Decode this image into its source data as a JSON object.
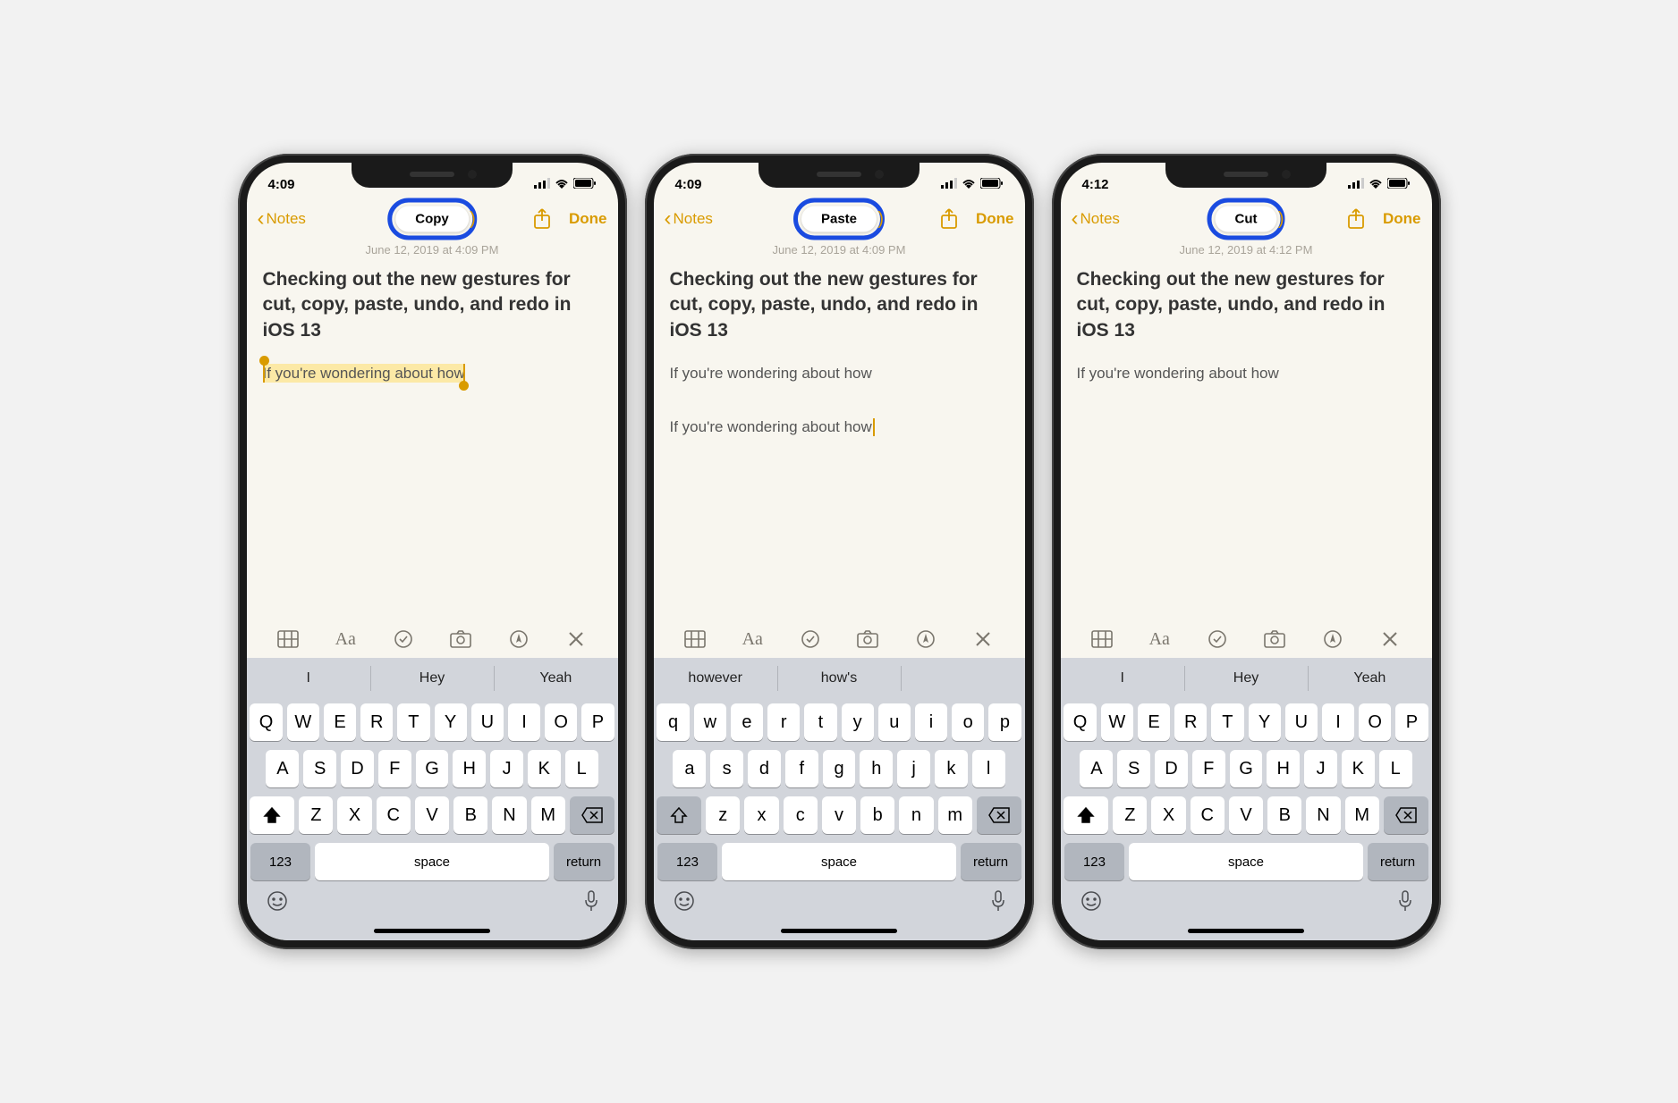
{
  "phones": [
    {
      "statusTime": "4:09",
      "backLabel": "Notes",
      "doneLabel": "Done",
      "badgeLabel": "Copy",
      "timestamp": "June 12, 2019 at 4:09 PM",
      "heading": "Checking out the new gestures for cut, copy, paste, undo, and redo in  iOS 13",
      "body1": "If you're wondering about how",
      "body1Style": "selected",
      "body2": "",
      "suggestions": [
        "I",
        "Hey",
        "Yeah"
      ],
      "row1": [
        "Q",
        "W",
        "E",
        "R",
        "T",
        "Y",
        "U",
        "I",
        "O",
        "P"
      ],
      "row2": [
        "A",
        "S",
        "D",
        "F",
        "G",
        "H",
        "J",
        "K",
        "L"
      ],
      "row3": [
        "Z",
        "X",
        "C",
        "V",
        "B",
        "N",
        "M"
      ],
      "shiftFilled": true,
      "numLabel": "123",
      "spaceLabel": "space",
      "returnLabel": "return"
    },
    {
      "statusTime": "4:09",
      "backLabel": "Notes",
      "doneLabel": "Done",
      "badgeLabel": "Paste",
      "timestamp": "June 12, 2019 at 4:09 PM",
      "heading": "Checking out the new gestures for cut, copy, paste, undo, and redo in  iOS 13",
      "body1": "If you're wondering about how",
      "body1Style": "plain",
      "body2": "If you're wondering about how",
      "body2Cursor": true,
      "suggestions": [
        "however",
        "how's",
        ""
      ],
      "row1": [
        "q",
        "w",
        "e",
        "r",
        "t",
        "y",
        "u",
        "i",
        "o",
        "p"
      ],
      "row2": [
        "a",
        "s",
        "d",
        "f",
        "g",
        "h",
        "j",
        "k",
        "l"
      ],
      "row3": [
        "z",
        "x",
        "c",
        "v",
        "b",
        "n",
        "m"
      ],
      "shiftFilled": false,
      "numLabel": "123",
      "spaceLabel": "space",
      "returnLabel": "return"
    },
    {
      "statusTime": "4:12",
      "backLabel": "Notes",
      "doneLabel": "Done",
      "badgeLabel": "Cut",
      "timestamp": "June 12, 2019 at 4:12 PM",
      "heading": "Checking out the new gestures for cut, copy, paste, undo, and redo in  iOS 13",
      "body1": "If you're wondering about how",
      "body1Style": "plain",
      "body2": "",
      "suggestions": [
        "I",
        "Hey",
        "Yeah"
      ],
      "row1": [
        "Q",
        "W",
        "E",
        "R",
        "T",
        "Y",
        "U",
        "I",
        "O",
        "P"
      ],
      "row2": [
        "A",
        "S",
        "D",
        "F",
        "G",
        "H",
        "J",
        "K",
        "L"
      ],
      "row3": [
        "Z",
        "X",
        "C",
        "V",
        "B",
        "N",
        "M"
      ],
      "shiftFilled": true,
      "numLabel": "123",
      "spaceLabel": "space",
      "returnLabel": "return"
    }
  ]
}
